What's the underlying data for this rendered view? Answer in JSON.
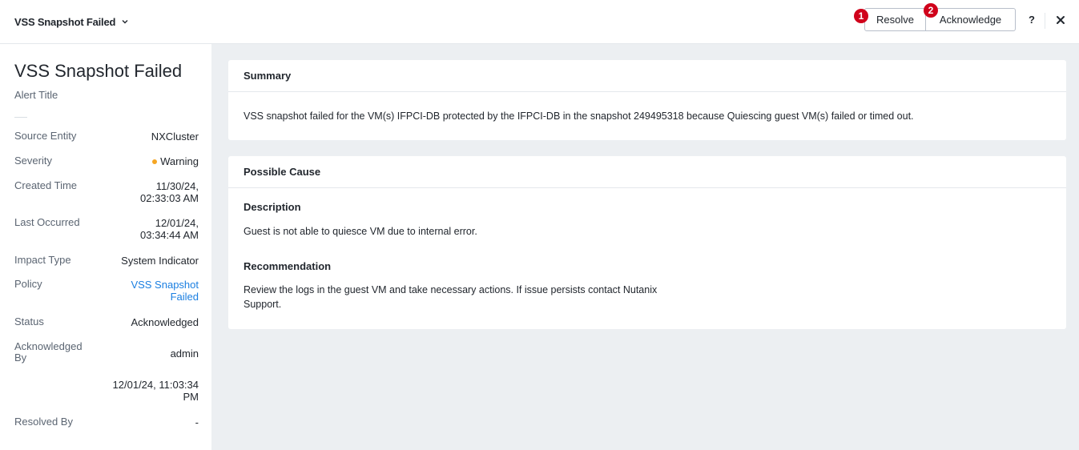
{
  "header": {
    "title": "VSS Snapshot Failed",
    "resolve_label": "Resolve",
    "acknowledge_label": "Acknowledge",
    "help_label": "?",
    "markers": [
      "1",
      "2"
    ]
  },
  "sidebar": {
    "title": "VSS Snapshot Failed",
    "subtitle": "Alert Title",
    "properties": [
      {
        "label": "Source Entity",
        "value": "NXCluster"
      },
      {
        "label": "Severity",
        "value": "Warning"
      },
      {
        "label": "Created Time",
        "value_line1": "11/30/24,",
        "value_line2": "02:33:03 AM"
      },
      {
        "label": "Last Occurred",
        "value_line1": "12/01/24,",
        "value_line2": "03:34:44 AM"
      },
      {
        "label": "Impact Type",
        "value": "System Indicator"
      },
      {
        "label": "Policy",
        "value_line1": "VSS Snapshot",
        "value_line2": "Failed"
      },
      {
        "label": "Status",
        "value": "Acknowledged"
      },
      {
        "label_line1": "Acknowledged",
        "label_line2": "By",
        "value": "admin"
      },
      {
        "value_line1": "12/01/24, 11:03:34",
        "value_line2": "PM"
      },
      {
        "label": "Resolved By",
        "value": "-"
      }
    ]
  },
  "summary": {
    "heading": "Summary",
    "text": "VSS snapshot failed for the VM(s) IFPCI-DB protected by the IFPCI-DB in the snapshot 249495318 because Quiescing guest VM(s) failed or timed out."
  },
  "cause": {
    "heading": "Possible Cause",
    "description_heading": "Description",
    "description": "Guest is not able to quiesce VM due to internal error.",
    "recommendation_heading": "Recommendation",
    "recommendation_line1": "Review the logs in the guest VM and take necessary actions. If issue persists contact Nutanix",
    "recommendation_line2": "Support."
  },
  "colors": {
    "link": "#1b7fe1",
    "warning_dot": "#f5a623",
    "marker": "#d0021b",
    "content_bg": "#eceff2"
  }
}
